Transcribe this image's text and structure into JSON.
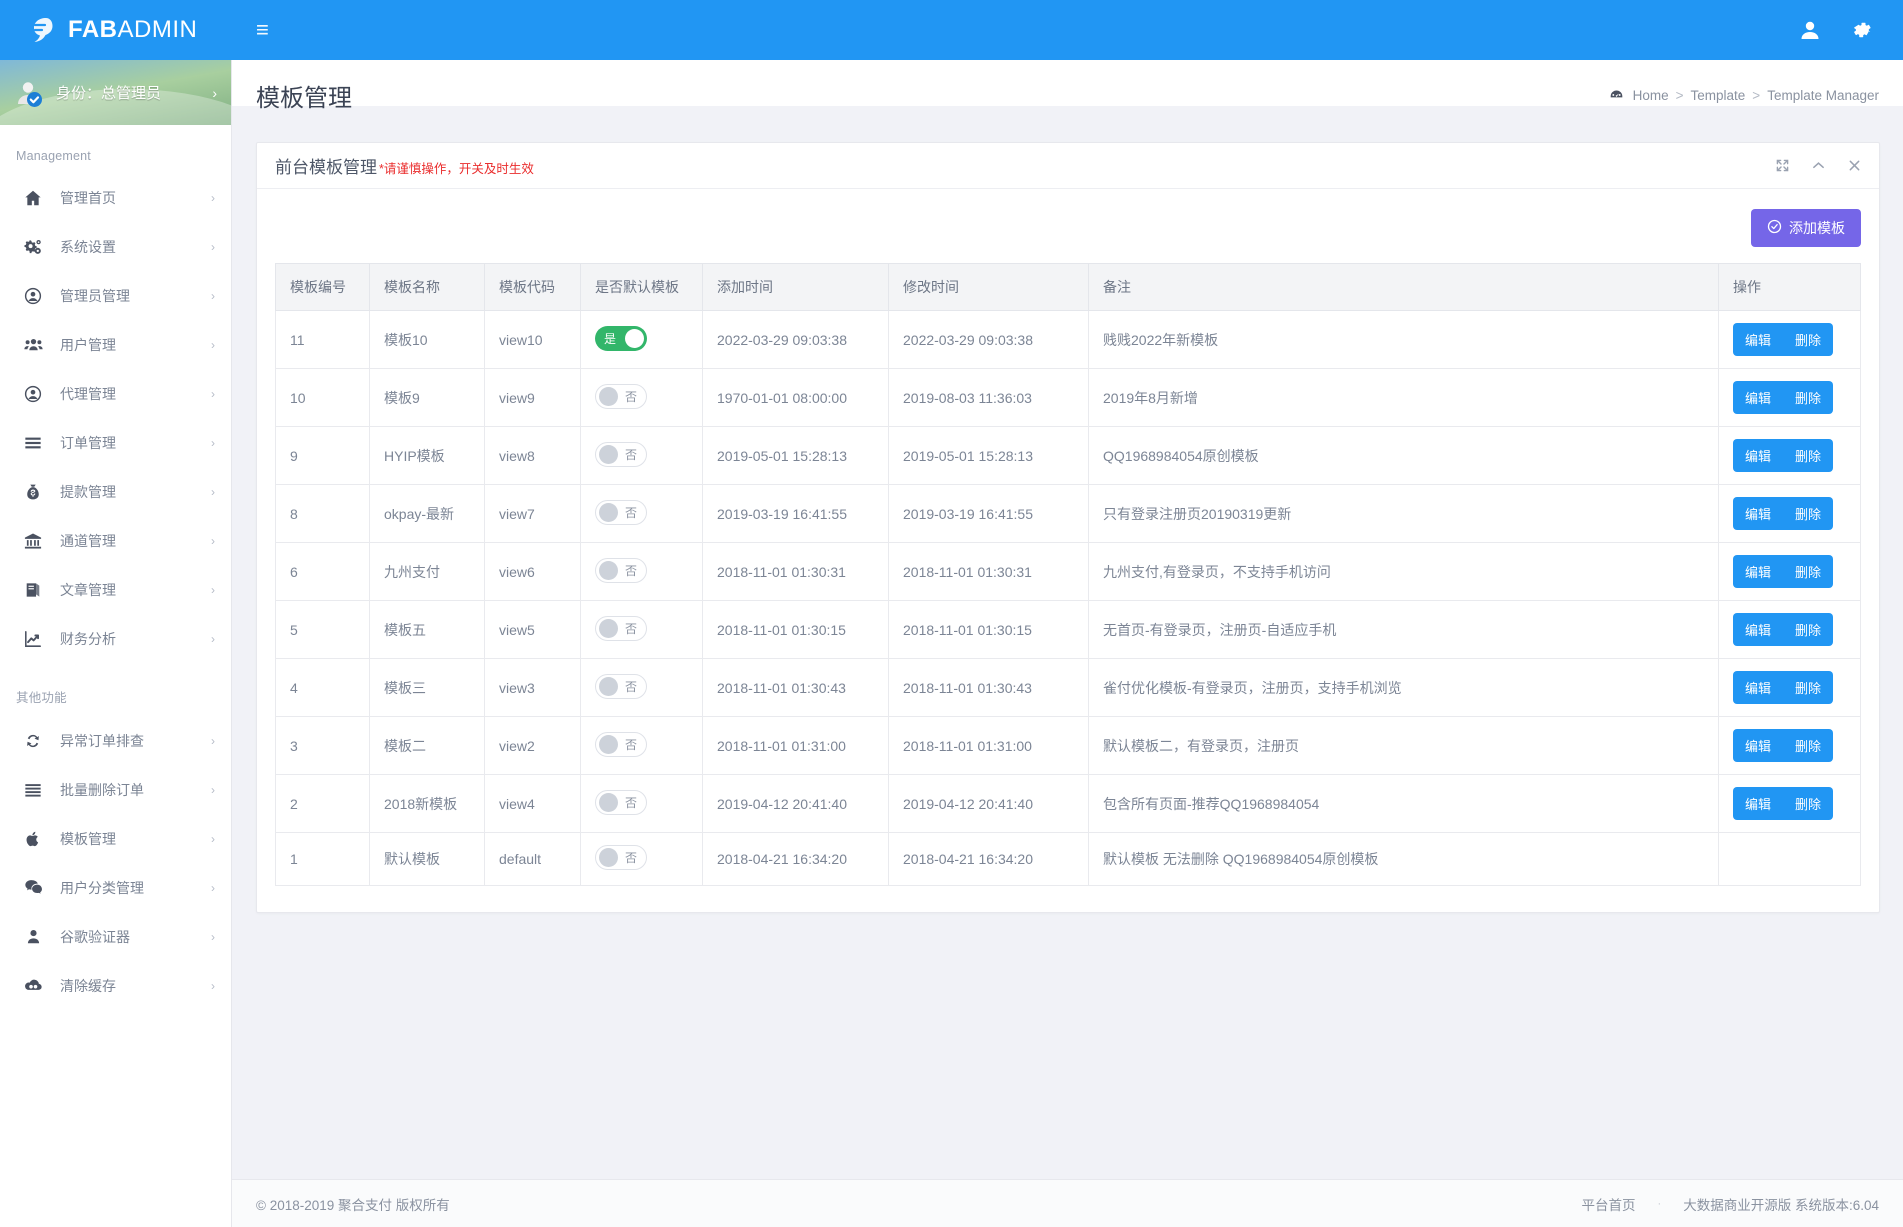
{
  "brand": {
    "bold": "FAB",
    "light": "ADMIN"
  },
  "topbar": {
    "menu_toggle_label": "≡",
    "user_icon": "user-icon",
    "settings_icon": "gear-icon"
  },
  "sidebar": {
    "profile": {
      "label": "身份：总管理员",
      "caret": "›"
    },
    "groups": [
      {
        "heading": "Management",
        "items": [
          {
            "label": "管理首页",
            "icon": "home-icon",
            "caret": "›"
          },
          {
            "label": "系统设置",
            "icon": "gears-icon",
            "caret": "›"
          },
          {
            "label": "管理员管理",
            "icon": "user-circle-icon",
            "caret": "›"
          },
          {
            "label": "用户管理",
            "icon": "users-icon",
            "caret": "›"
          },
          {
            "label": "代理管理",
            "icon": "user-circle-icon",
            "caret": "›"
          },
          {
            "label": "订单管理",
            "icon": "list-icon",
            "caret": "›"
          },
          {
            "label": "提款管理",
            "icon": "money-bag-icon",
            "caret": "›"
          },
          {
            "label": "通道管理",
            "icon": "bank-icon",
            "caret": "›"
          },
          {
            "label": "文章管理",
            "icon": "book-icon",
            "caret": "›"
          },
          {
            "label": "财务分析",
            "icon": "chart-line-icon",
            "caret": "›"
          }
        ]
      },
      {
        "heading": "其他功能",
        "items": [
          {
            "label": "异常订单排查",
            "icon": "refresh-icon",
            "caret": "›"
          },
          {
            "label": "批量删除订单",
            "icon": "list-icon",
            "caret": "›"
          },
          {
            "label": "模板管理",
            "icon": "apple-icon",
            "caret": "›"
          },
          {
            "label": "用户分类管理",
            "icon": "wechat-icon",
            "caret": "›"
          },
          {
            "label": "谷歌验证器",
            "icon": "user-solid-icon",
            "caret": "›"
          },
          {
            "label": "清除缓存",
            "icon": "cloud-icon",
            "caret": "›"
          }
        ]
      }
    ]
  },
  "page": {
    "title": "模板管理",
    "breadcrumb": {
      "home_icon": "dashboard-icon",
      "items": [
        "Home",
        "Template",
        "Template Manager"
      ],
      "separator": ">"
    }
  },
  "card": {
    "title": "前台模板管理",
    "warning": "*请谨慎操作，开关及时生效",
    "tools": [
      {
        "name": "expand-icon",
        "glyph": "⤢"
      },
      {
        "name": "collapse-icon",
        "glyph": "⌃"
      },
      {
        "name": "close-icon",
        "glyph": "✕"
      }
    ],
    "add_button": {
      "label": "添加模板",
      "icon": "check-circle-icon",
      "color": "#7566e8"
    }
  },
  "table": {
    "columns": [
      "模板编号",
      "模板名称",
      "模板代码",
      "是否默认模板",
      "添加时间",
      "修改时间",
      "备注",
      "操作"
    ],
    "toggle_on_label": "是",
    "toggle_off_label": "否",
    "edit_label": "编辑",
    "delete_label": "删除",
    "rows": [
      {
        "id": "11",
        "name": "模板10",
        "code": "view10",
        "is_default": true,
        "added": "2022-03-29 09:03:38",
        "modified": "2022-03-29 09:03:38",
        "note": "贱贱2022年新模板",
        "actions": true
      },
      {
        "id": "10",
        "name": "模板9",
        "code": "view9",
        "is_default": false,
        "added": "1970-01-01 08:00:00",
        "modified": "2019-08-03 11:36:03",
        "note": "2019年8月新增",
        "actions": true
      },
      {
        "id": "9",
        "name": "HYIP模板",
        "code": "view8",
        "is_default": false,
        "added": "2019-05-01 15:28:13",
        "modified": "2019-05-01 15:28:13",
        "note": "QQ1968984054原创模板",
        "actions": true
      },
      {
        "id": "8",
        "name": "okpay-最新",
        "code": "view7",
        "is_default": false,
        "added": "2019-03-19 16:41:55",
        "modified": "2019-03-19 16:41:55",
        "note": "只有登录注册页20190319更新",
        "actions": true
      },
      {
        "id": "6",
        "name": "九州支付",
        "code": "view6",
        "is_default": false,
        "added": "2018-11-01 01:30:31",
        "modified": "2018-11-01 01:30:31",
        "note": "九州支付,有登录页，不支持手机访问",
        "actions": true
      },
      {
        "id": "5",
        "name": "模板五",
        "code": "view5",
        "is_default": false,
        "added": "2018-11-01 01:30:15",
        "modified": "2018-11-01 01:30:15",
        "note": "无首页-有登录页，注册页-自适应手机",
        "actions": true
      },
      {
        "id": "4",
        "name": "模板三",
        "code": "view3",
        "is_default": false,
        "added": "2018-11-01 01:30:43",
        "modified": "2018-11-01 01:30:43",
        "note": "雀付优化模板-有登录页，注册页，支持手机浏览",
        "actions": true
      },
      {
        "id": "3",
        "name": "模板二",
        "code": "view2",
        "is_default": false,
        "added": "2018-11-01 01:31:00",
        "modified": "2018-11-01 01:31:00",
        "note": "默认模板二，有登录页，注册页",
        "actions": true
      },
      {
        "id": "2",
        "name": "2018新模板",
        "code": "view4",
        "is_default": false,
        "added": "2019-04-12 20:41:40",
        "modified": "2019-04-12 20:41:40",
        "note": "包含所有页面-推荐QQ1968984054",
        "actions": true
      },
      {
        "id": "1",
        "name": "默认模板",
        "code": "default",
        "is_default": false,
        "added": "2018-04-21 16:34:20",
        "modified": "2018-04-21 16:34:20",
        "note": "默认模板 无法删除 QQ1968984054原创模板",
        "actions": false
      }
    ]
  },
  "footer": {
    "copyright": "© 2018-2019 聚合支付 版权所有",
    "platform_link": "平台首页",
    "dot": "·",
    "version": "大数据商业开源版 系统版本:6.04"
  },
  "colors": {
    "primary": "#2196f3",
    "accent": "#7566e8",
    "toggle_on": "#32b66a",
    "warning": "#ea2d2d"
  }
}
